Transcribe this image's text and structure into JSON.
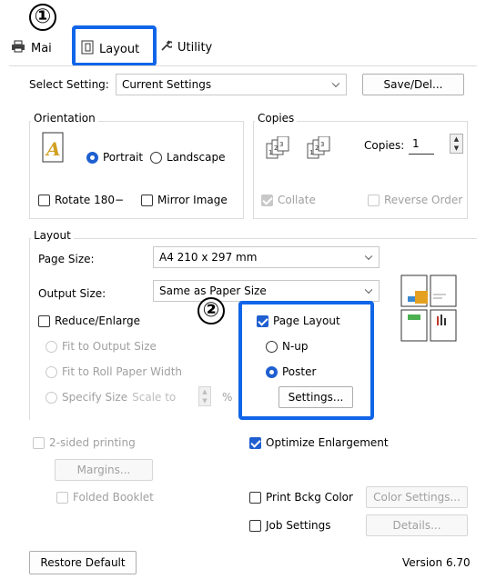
{
  "callouts": {
    "one": "①",
    "two": "②"
  },
  "tabs": [
    {
      "label": "Mai",
      "icon": "printer-icon"
    },
    {
      "label": "Layout",
      "icon": "page-icon"
    },
    {
      "label": "Utility",
      "icon": "wrench-icon"
    }
  ],
  "select_setting": {
    "label": "Select Setting:",
    "value": "Current Settings",
    "save_button": "Save/Del..."
  },
  "orientation": {
    "title": "Orientation",
    "portrait": "Portrait",
    "landscape": "Landscape",
    "rotate": "Rotate 180−",
    "mirror": "Mirror Image"
  },
  "copies": {
    "title": "Copies",
    "copies_label": "Copies:",
    "copies_value": "1",
    "collate": "Collate",
    "reverse_order": "Reverse Order"
  },
  "layout": {
    "title": "Layout",
    "page_size_label": "Page Size:",
    "page_size_value": "A4 210 x 297 mm",
    "output_size_label": "Output Size:",
    "output_size_value": "Same as Paper Size",
    "reduce_enlarge": "Reduce/Enlarge",
    "fit_output": "Fit to Output Size",
    "fit_roll": "Fit to Roll Paper Width",
    "specify_size": "Specify Size",
    "scale_to": "Scale to",
    "percent": "%",
    "page_layout": "Page Layout",
    "n_up": "N-up",
    "poster": "Poster",
    "settings_button": "Settings..."
  },
  "two_sided": "2-sided printing",
  "margins_button": "Margins...",
  "folded_booklet": "Folded Booklet",
  "optimize_enlargement": "Optimize Enlargement",
  "print_bckg_color": "Print Bckg Color",
  "color_settings_button": "Color Settings...",
  "job_settings": "Job Settings",
  "details_button": "Details...",
  "restore_default": "Restore Default",
  "version": "Version 6.70",
  "colors": {
    "highlight": "#1165e8",
    "accent": "#1f5fd0"
  }
}
